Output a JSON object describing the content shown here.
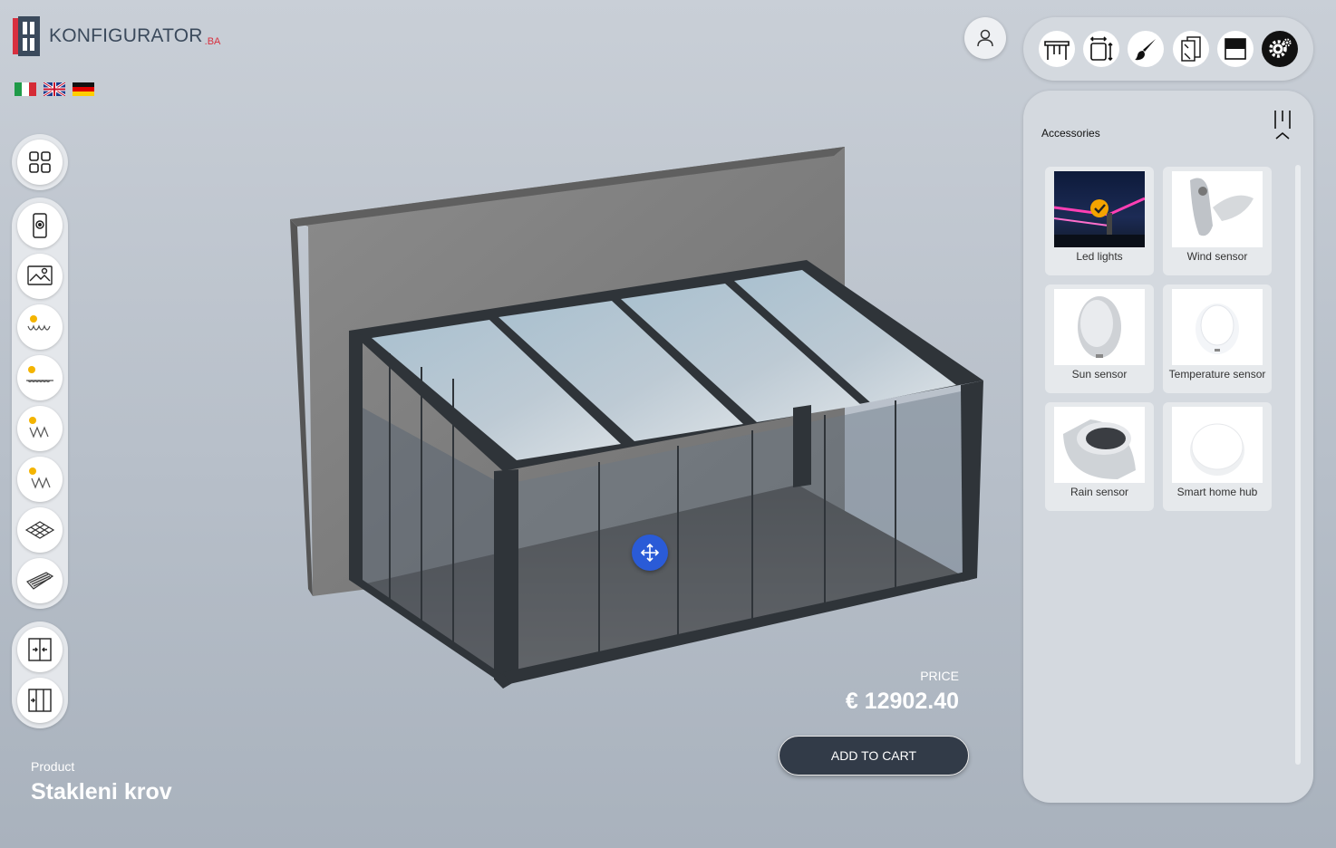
{
  "brand": {
    "name": "KONFIGURATOR",
    "suffix": ".BA"
  },
  "languages": [
    {
      "code": "it",
      "icon": "flag-italy-icon"
    },
    {
      "code": "en",
      "icon": "flag-uk-icon"
    },
    {
      "code": "de",
      "icon": "flag-germany-icon"
    }
  ],
  "left_rail": {
    "groups": [
      [
        "grid-view-icon"
      ],
      [
        "phone-remote-icon",
        "landscape-settings-icon",
        "sun-shade-1-icon",
        "sun-shade-2-icon",
        "sun-shade-3-icon",
        "sun-shade-4-icon",
        "roof-grid-icon",
        "wall-panel-icon"
      ],
      [
        "sliding-door-icon",
        "folding-door-icon"
      ]
    ]
  },
  "top_toolbar": {
    "items": [
      "pergola-icon",
      "dimensions-icon",
      "paint-brush-icon",
      "glass-panels-icon",
      "roof-cover-icon",
      "settings-gear-icon"
    ],
    "active": "settings-gear-icon"
  },
  "panel": {
    "title": "Accessories",
    "items": [
      {
        "label": "Led lights",
        "selected": true
      },
      {
        "label": "Wind sensor",
        "selected": false
      },
      {
        "label": "Sun sensor",
        "selected": false
      },
      {
        "label": "Temperature sensor",
        "selected": false
      },
      {
        "label": "Rain sensor",
        "selected": false
      },
      {
        "label": "Smart home hub",
        "selected": false
      }
    ]
  },
  "product": {
    "label": "Product",
    "name": "Stakleni krov"
  },
  "price": {
    "label": "PRICE",
    "value": "€ 12902.40"
  },
  "cart": {
    "label": "ADD TO CART"
  },
  "colors": {
    "accent": "#2a5bd7",
    "cart": "#323b48",
    "brand_red": "#d8303f",
    "selected_badge": "#f4a300"
  }
}
